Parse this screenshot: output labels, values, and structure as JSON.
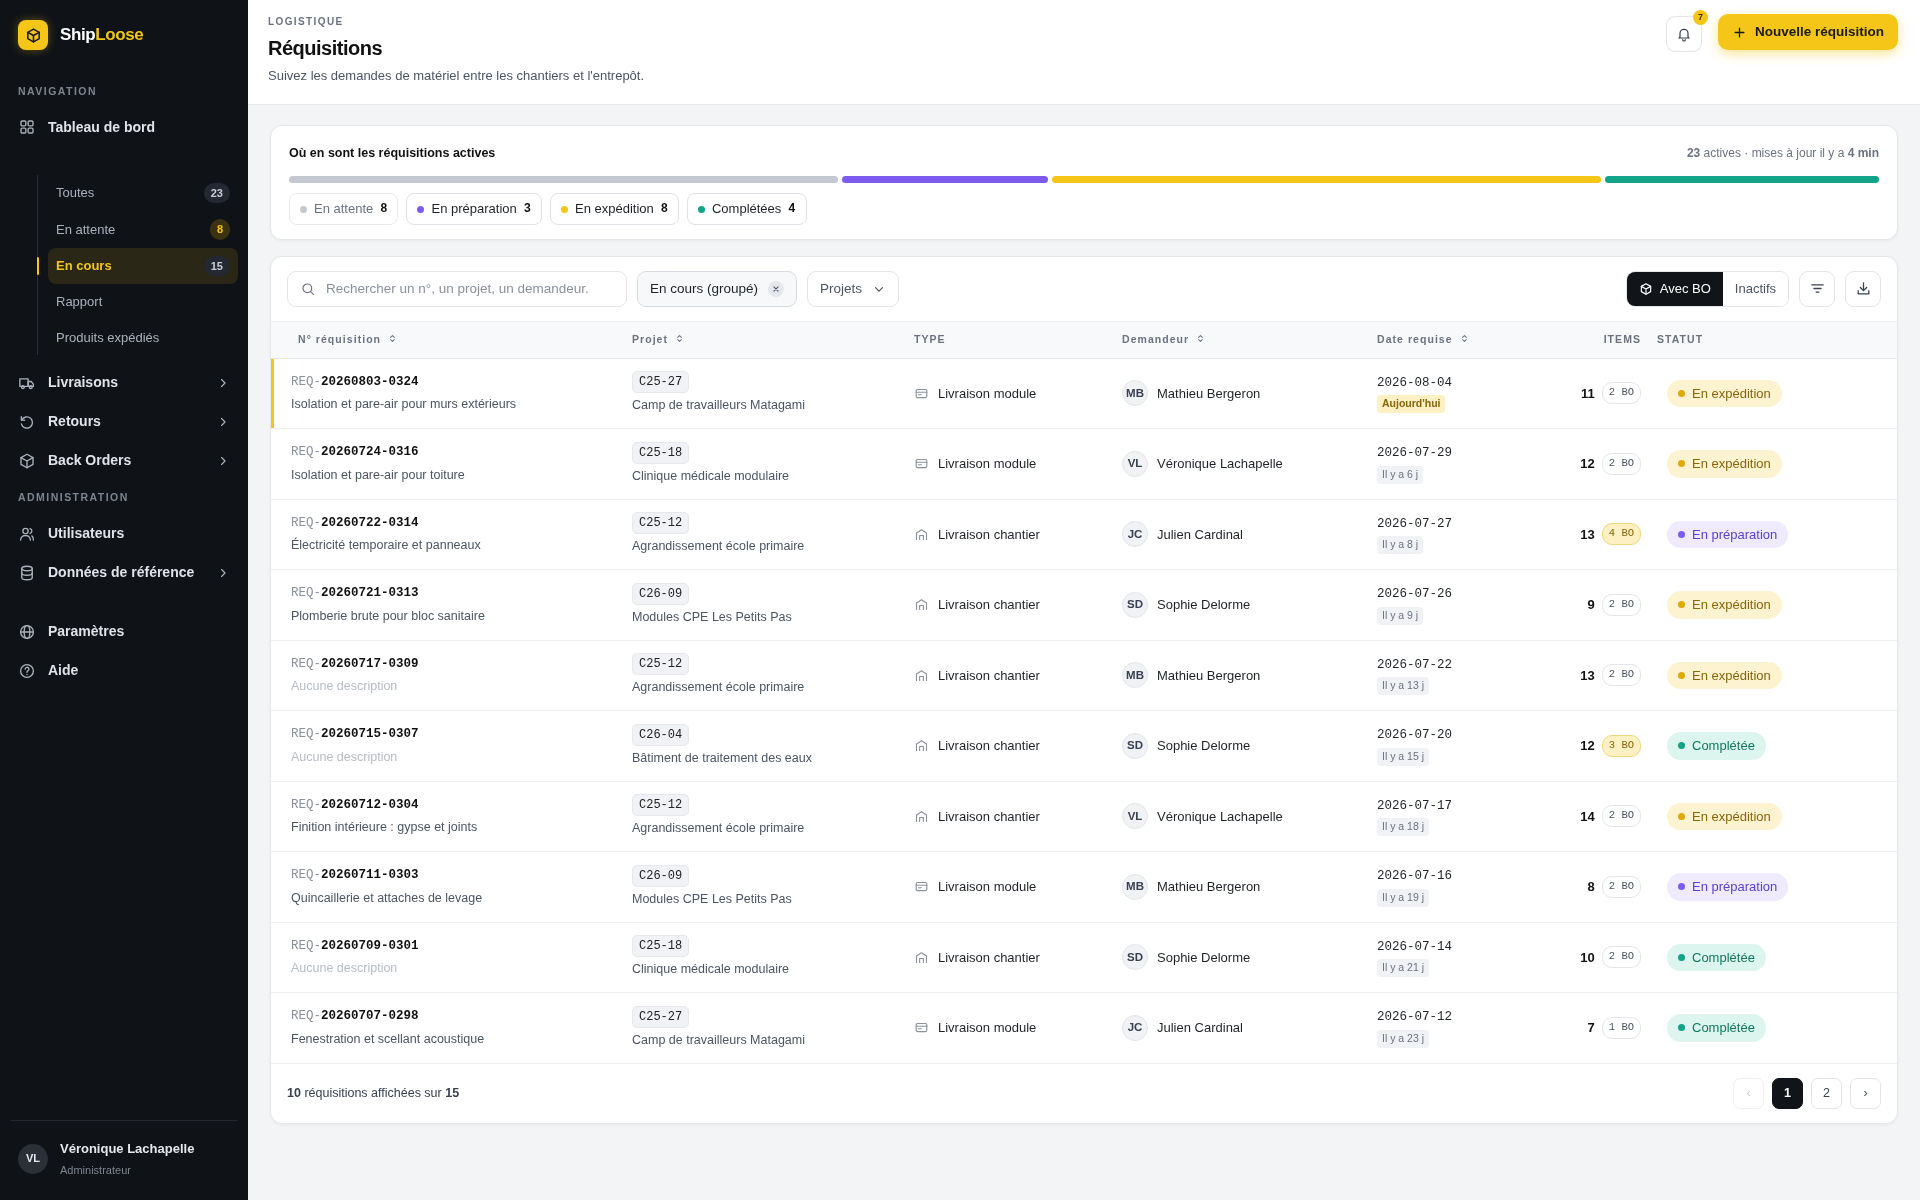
{
  "brand": {
    "primary": "Ship",
    "accent": "Loose"
  },
  "sidebar": {
    "sections": [
      {
        "heading": "NAVIGATION",
        "items": [
          {
            "kind": "link",
            "label": "Tableau de bord"
          },
          {
            "kind": "subnav",
            "children": [
              {
                "label": "Toutes",
                "count": "23",
                "count_alert": false,
                "selected": false
              },
              {
                "label": "En attente",
                "count": "8",
                "count_alert": true,
                "selected": false
              },
              {
                "label": "En cours",
                "count": "15",
                "count_alert": false,
                "selected": true
              },
              {
                "label": "Rapport",
                "selected": false
              },
              {
                "label": "Produits expédiés",
                "selected": false
              }
            ]
          },
          {
            "kind": "link",
            "label": "Livraisons",
            "expanded": false
          },
          {
            "kind": "link",
            "label": "Retours",
            "expanded": false
          },
          {
            "kind": "link",
            "label": "Back Orders",
            "expanded": false
          }
        ]
      },
      {
        "heading": "ADMINISTRATION",
        "items": [
          {
            "kind": "link",
            "label": "Utilisateurs"
          },
          {
            "kind": "link",
            "label": "Données de référence",
            "expanded": false
          }
        ]
      },
      {
        "items": [
          {
            "kind": "link",
            "label": "Paramètres"
          },
          {
            "kind": "link",
            "label": "Aide"
          }
        ]
      }
    ],
    "user": {
      "initials": "VL",
      "name": "Véronique Lachapelle",
      "role": "Administrateur"
    }
  },
  "header": {
    "eyebrow": "LOGISTIQUE",
    "title": "Réquisitions",
    "subtitle": "Suivez les demandes de matériel entre les chantiers et l'entrepôt.",
    "notifications": "7",
    "primary_button": "Nouvelle réquisition"
  },
  "summary": {
    "title": "Où en sont les réquisitions actives",
    "meta": "**23** actives · mises à jour il y a **4 min**",
    "segments": [
      {
        "label": "En attente",
        "count": "8",
        "color": "#c4c8cf",
        "selected": false
      },
      {
        "label": "En préparation",
        "count": "3",
        "color": "#7c5cf0",
        "selected": true
      },
      {
        "label": "En expédition",
        "count": "8",
        "color": "#f5c518",
        "selected": true
      },
      {
        "label": "Complétées",
        "count": "4",
        "color": "#13a386",
        "selected": true
      }
    ]
  },
  "toolbar": {
    "search": {
      "placeholder": "Rechercher un n°, un projet, un demandeur."
    },
    "active_filter": "En cours (groupé)",
    "dropdown": "Projets",
    "toggles": [
      {
        "label": "Avec BO",
        "selected": true
      },
      {
        "label": "Inactifs",
        "selected": false
      }
    ]
  },
  "table": {
    "columns": [
      {
        "label": "N° réquisition",
        "sortable": true
      },
      {
        "label": "Projet",
        "sortable": true
      },
      {
        "label": "TYPE",
        "sortable": false
      },
      {
        "label": "Demandeur",
        "sortable": true
      },
      {
        "label": "Date requise",
        "sortable": true
      },
      {
        "label": "ITEMS",
        "sortable": false
      },
      {
        "label": "STATUT",
        "sortable": false
      }
    ],
    "rows": [
      {
        "selected": true,
        "prefix": "REQ-",
        "number": "20260803-0324",
        "description": "Isolation et pare-air pour murs extérieurs",
        "description_muted": false,
        "project_code": "C25-27",
        "project_name": "Camp de travailleurs Matagami",
        "type": {
          "kind": "module",
          "label": "Livraison module"
        },
        "initials": "MB",
        "requester": "Mathieu Bergeron",
        "date": "2026-08-04",
        "relative": "Aujourd'hui",
        "due_today": true,
        "items": "11",
        "bo": "2 BO",
        "bo_alert": false,
        "status": {
          "kind": "shipping",
          "label": "En expédition"
        }
      },
      {
        "selected": false,
        "prefix": "REQ-",
        "number": "20260724-0316",
        "description": "Isolation et pare-air pour toiture",
        "description_muted": false,
        "project_code": "C25-18",
        "project_name": "Clinique médicale modulaire",
        "type": {
          "kind": "module",
          "label": "Livraison module"
        },
        "initials": "VL",
        "requester": "Véronique Lachapelle",
        "date": "2026-07-29",
        "relative": "Il y a 6 j",
        "due_today": false,
        "items": "12",
        "bo": "2 BO",
        "bo_alert": false,
        "status": {
          "kind": "shipping",
          "label": "En expédition"
        }
      },
      {
        "selected": false,
        "prefix": "REQ-",
        "number": "20260722-0314",
        "description": "Électricité temporaire et panneaux",
        "description_muted": false,
        "project_code": "C25-12",
        "project_name": "Agrandissement école primaire",
        "type": {
          "kind": "site",
          "label": "Livraison chantier"
        },
        "initials": "JC",
        "requester": "Julien Cardinal",
        "date": "2026-07-27",
        "relative": "Il y a 8 j",
        "due_today": false,
        "items": "13",
        "bo": "4 BO",
        "bo_alert": true,
        "status": {
          "kind": "preparing",
          "label": "En préparation"
        }
      },
      {
        "selected": false,
        "prefix": "REQ-",
        "number": "20260721-0313",
        "description": "Plomberie brute pour bloc sanitaire",
        "description_muted": false,
        "project_code": "C26-09",
        "project_name": "Modules CPE Les Petits Pas",
        "type": {
          "kind": "site",
          "label": "Livraison chantier"
        },
        "initials": "SD",
        "requester": "Sophie Delorme",
        "date": "2026-07-26",
        "relative": "Il y a 9 j",
        "due_today": false,
        "items": "9",
        "bo": "2 BO",
        "bo_alert": false,
        "status": {
          "kind": "shipping",
          "label": "En expédition"
        }
      },
      {
        "selected": false,
        "prefix": "REQ-",
        "number": "20260717-0309",
        "description": "Aucune description",
        "description_muted": true,
        "project_code": "C25-12",
        "project_name": "Agrandissement école primaire",
        "type": {
          "kind": "site",
          "label": "Livraison chantier"
        },
        "initials": "MB",
        "requester": "Mathieu Bergeron",
        "date": "2026-07-22",
        "relative": "Il y a 13 j",
        "due_today": false,
        "items": "13",
        "bo": "2 BO",
        "bo_alert": false,
        "status": {
          "kind": "shipping",
          "label": "En expédition"
        }
      },
      {
        "selected": false,
        "prefix": "REQ-",
        "number": "20260715-0307",
        "description": "Aucune description",
        "description_muted": true,
        "project_code": "C26-04",
        "project_name": "Bâtiment de traitement des eaux",
        "type": {
          "kind": "site",
          "label": "Livraison chantier"
        },
        "initials": "SD",
        "requester": "Sophie Delorme",
        "date": "2026-07-20",
        "relative": "Il y a 15 j",
        "due_today": false,
        "items": "12",
        "bo": "3 BO",
        "bo_alert": true,
        "status": {
          "kind": "done",
          "label": "Complétée"
        }
      },
      {
        "selected": false,
        "prefix": "REQ-",
        "number": "20260712-0304",
        "description": "Finition intérieure : gypse et joints",
        "description_muted": false,
        "project_code": "C25-12",
        "project_name": "Agrandissement école primaire",
        "type": {
          "kind": "site",
          "label": "Livraison chantier"
        },
        "initials": "VL",
        "requester": "Véronique Lachapelle",
        "date": "2026-07-17",
        "relative": "Il y a 18 j",
        "due_today": false,
        "items": "14",
        "bo": "2 BO",
        "bo_alert": false,
        "status": {
          "kind": "shipping",
          "label": "En expédition"
        }
      },
      {
        "selected": false,
        "prefix": "REQ-",
        "number": "20260711-0303",
        "description": "Quincaillerie et attaches de levage",
        "description_muted": false,
        "project_code": "C26-09",
        "project_name": "Modules CPE Les Petits Pas",
        "type": {
          "kind": "module",
          "label": "Livraison module"
        },
        "initials": "MB",
        "requester": "Mathieu Bergeron",
        "date": "2026-07-16",
        "relative": "Il y a 19 j",
        "due_today": false,
        "items": "8",
        "bo": "2 BO",
        "bo_alert": false,
        "status": {
          "kind": "preparing",
          "label": "En préparation"
        }
      },
      {
        "selected": false,
        "prefix": "REQ-",
        "number": "20260709-0301",
        "description": "Aucune description",
        "description_muted": true,
        "project_code": "C25-18",
        "project_name": "Clinique médicale modulaire",
        "type": {
          "kind": "site",
          "label": "Livraison chantier"
        },
        "initials": "SD",
        "requester": "Sophie Delorme",
        "date": "2026-07-14",
        "relative": "Il y a 21 j",
        "due_today": false,
        "items": "10",
        "bo": "2 BO",
        "bo_alert": false,
        "status": {
          "kind": "done",
          "label": "Complétée"
        }
      },
      {
        "selected": false,
        "prefix": "REQ-",
        "number": "20260707-0298",
        "description": "Fenestration et scellant acoustique",
        "description_muted": false,
        "project_code": "C25-27",
        "project_name": "Camp de travailleurs Matagami",
        "type": {
          "kind": "module",
          "label": "Livraison module"
        },
        "initials": "JC",
        "requester": "Julien Cardinal",
        "date": "2026-07-12",
        "relative": "Il y a 23 j",
        "due_today": false,
        "items": "7",
        "bo": "1 BO",
        "bo_alert": false,
        "status": {
          "kind": "done",
          "label": "Complétée"
        }
      }
    ]
  },
  "footer": {
    "summary": "**10** réquisitions affichées sur **15**",
    "pages": [
      {
        "label": "‹",
        "disabled": true,
        "selected": false
      },
      {
        "label": "1",
        "selected": true
      },
      {
        "label": "2",
        "selected": false
      },
      {
        "label": "›",
        "disabled": false,
        "selected": false
      }
    ]
  }
}
